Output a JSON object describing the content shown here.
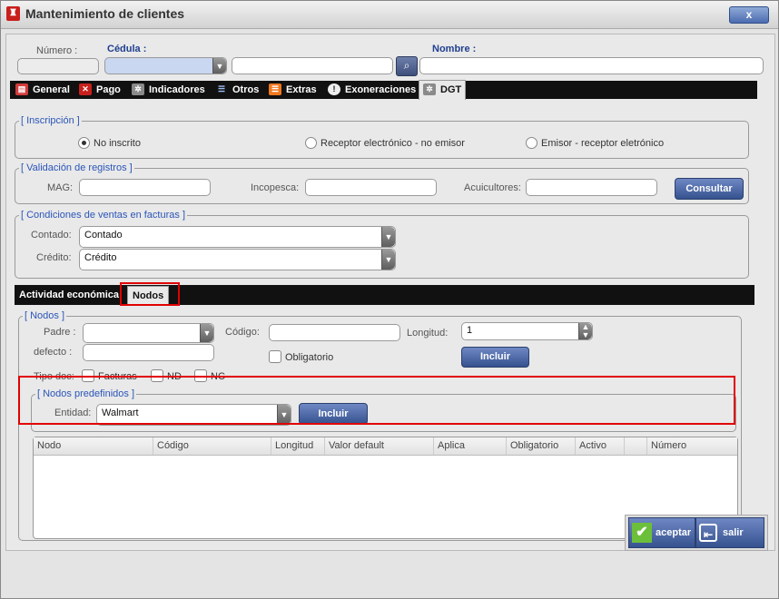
{
  "window": {
    "title": "Mantenimiento de clientes",
    "close_label": "x"
  },
  "header": {
    "numero_label": "Número :",
    "cedula_label": "Cédula :",
    "nombre_label": "Nombre :",
    "numero_value": "",
    "cedula_type_value": "",
    "cedula_value": "",
    "nombre_value": ""
  },
  "tabs": [
    {
      "label": "General",
      "icon": "general-icon",
      "color": "#d23b3b"
    },
    {
      "label": "Pago",
      "icon": "payment-icon",
      "color": "#c8201c"
    },
    {
      "label": "Indicadores",
      "icon": "gear-icon",
      "color": "#8a8a8a"
    },
    {
      "label": "Otros",
      "icon": "list-icon",
      "color": "#3a6fc4"
    },
    {
      "label": "Extras",
      "icon": "extras-icon",
      "color": "#f0781e"
    },
    {
      "label": "Exoneraciones",
      "icon": "info-icon",
      "color": "#eeeeee"
    },
    {
      "label": "DGT",
      "icon": "gear-icon",
      "color": "#8a8a8a",
      "active": true
    }
  ],
  "inscripcion": {
    "legend": "[ Inscripción ]",
    "options": [
      "No inscrito",
      "Receptor electrónico - no emisor",
      "Emisor - receptor eletrónico"
    ],
    "selected": "No inscrito"
  },
  "validacion": {
    "legend": "[ Validación de registros ]",
    "mag_label": "MAG:",
    "incopesca_label": "Incopesca:",
    "acuicultores_label": "Acuicultores:",
    "consultar_label": "Consultar"
  },
  "condiciones": {
    "legend": "[ Condiciones de ventas en facturas ]",
    "contado_label": "Contado:",
    "contado_value": "Contado",
    "credito_label": "Crédito:",
    "credito_value": "Crédito"
  },
  "subtabs": [
    {
      "label": "Actividad económica"
    },
    {
      "label": "Nodos",
      "active": true
    }
  ],
  "nodos": {
    "legend": "[ Nodos ]",
    "padre_label": "Padre :",
    "defecto_label": "defecto :",
    "codigo_label": "Código:",
    "longitud_label": "Longitud:",
    "longitud_value": "1",
    "obligatorio_label": "Obligatorio",
    "incluir_label": "Incluir",
    "tipo_doc_label": "Tipo doc:",
    "doc_types": [
      "Facturas",
      "ND",
      "NC"
    ]
  },
  "predefinidos": {
    "legend": "[ Nodos predefinidos ]",
    "entidad_label": "Entidad:",
    "entidad_value": "Walmart",
    "incluir_label": "Incluir"
  },
  "grid": {
    "columns": [
      "Nodo",
      "Código",
      "Longitud",
      "Valor default",
      "Aplica",
      "Obligatorio",
      "Activo",
      "",
      "Número"
    ],
    "rows": []
  },
  "footer": {
    "aceptar_label": "aceptar",
    "salir_label": "salir"
  }
}
